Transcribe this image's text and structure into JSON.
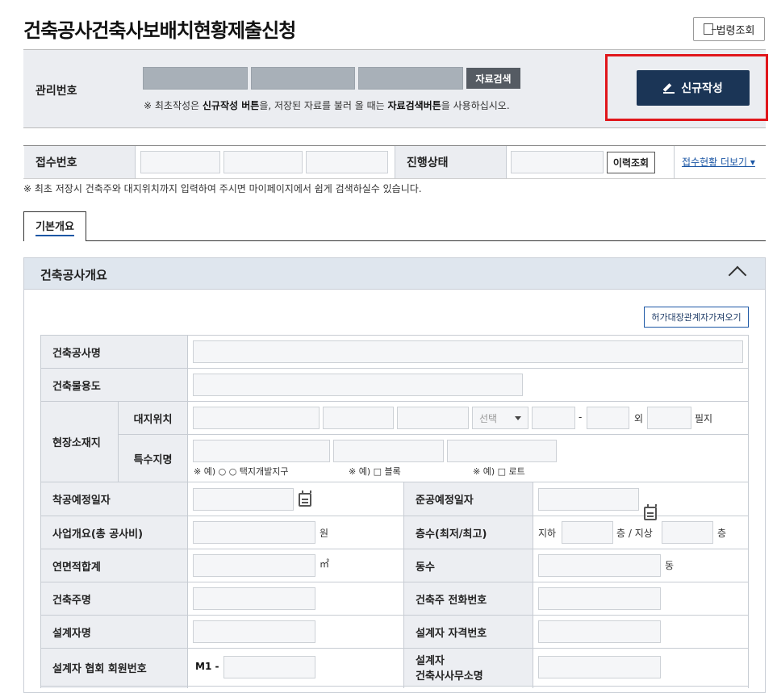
{
  "page": {
    "title": "건축공사건축사보배치현황제출신청",
    "law_button": "법령조회"
  },
  "management": {
    "label": "관리번호",
    "search_button": "자료검색",
    "note_prefix": "※ 최초작성은 ",
    "note_bold1": "신규작성 버튼",
    "note_mid": "을, 저장된 자료를 불러 올 때는 ",
    "note_bold2": "자료검색버튼",
    "note_suffix": "을 사용하십시오.",
    "new_button": "신규작성"
  },
  "receipt": {
    "number_label": "접수번호",
    "status_label": "진행상태",
    "history_button": "이력조회",
    "more_link": "접수현황 더보기 ▾",
    "note": "※ 최초 저장시 건축주와 대지위치까지 입력하여 주시면 마이페이지에서 쉽게 검색하실수 있습니다."
  },
  "tabs": [
    {
      "label": "기본개요"
    }
  ],
  "section": {
    "title": "건축공사개요",
    "fetch_button": "허가대장관계자가져오기"
  },
  "form": {
    "project_name": "건축공사명",
    "purpose": "건축물용도",
    "site_location": "현장소재지",
    "land_location": "대지위치",
    "select_placeholder": "선택",
    "dash": "-",
    "outside": "외",
    "parcel_unit": "필지",
    "special_place": "특수지명",
    "example1": "※ 예) ○ ○ 택지개발지구",
    "example2": "※ 예) □ 블록",
    "example3": "※ 예) □ 로트",
    "start_date": "착공예정일자",
    "completion_date": "준공예정일자",
    "business_cost": "사업개요(총 공사비)",
    "won": "원",
    "floors": "층수(최저/최고)",
    "basement": "지하",
    "floor_sep": "층 / 지상",
    "floor_unit": "층",
    "total_area": "연면적합계",
    "sqm": "㎡",
    "building_count": "동수",
    "dong": "동",
    "owner_name": "건축주명",
    "owner_phone": "건축주 전화번호",
    "designer_name": "설계자명",
    "designer_license": "설계자 자격번호",
    "designer_member_no": "설계자 협회 회원번호",
    "member_prefix": "M1 -",
    "designer_office_1": "설계자",
    "designer_office_2": "건축사사무소명"
  }
}
